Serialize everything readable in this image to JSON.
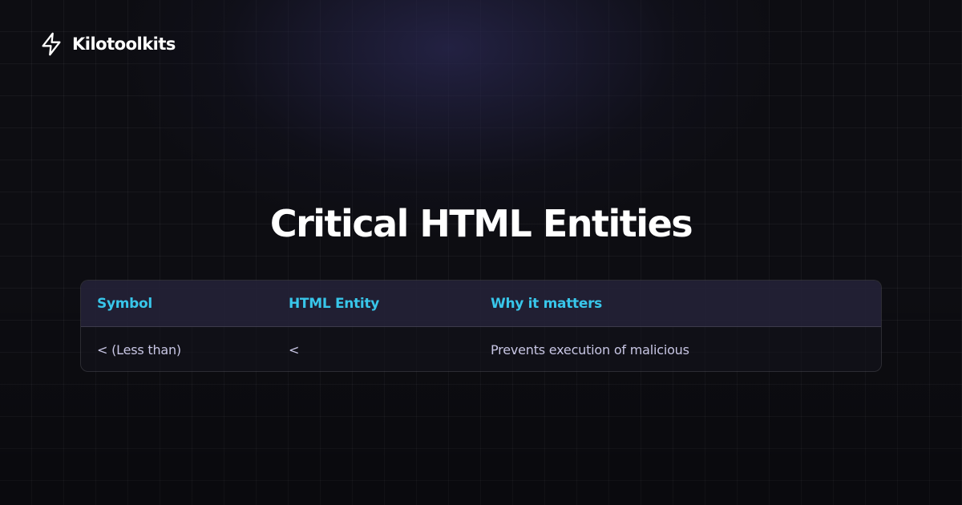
{
  "brand": {
    "name": "Kilotoolkits",
    "icon": "lightning-bolt-icon"
  },
  "title": "Critical HTML Entities",
  "table": {
    "headers": [
      "Symbol",
      "HTML Entity",
      "Why it matters"
    ],
    "rows": [
      [
        "< (Less than)",
        "<",
        "Prevents execution of malicious"
      ]
    ]
  },
  "colors": {
    "background": "#0d0d12",
    "header_text": "#38c6ea",
    "cell_text": "#c8c6e4",
    "title_text": "#ffffff"
  }
}
